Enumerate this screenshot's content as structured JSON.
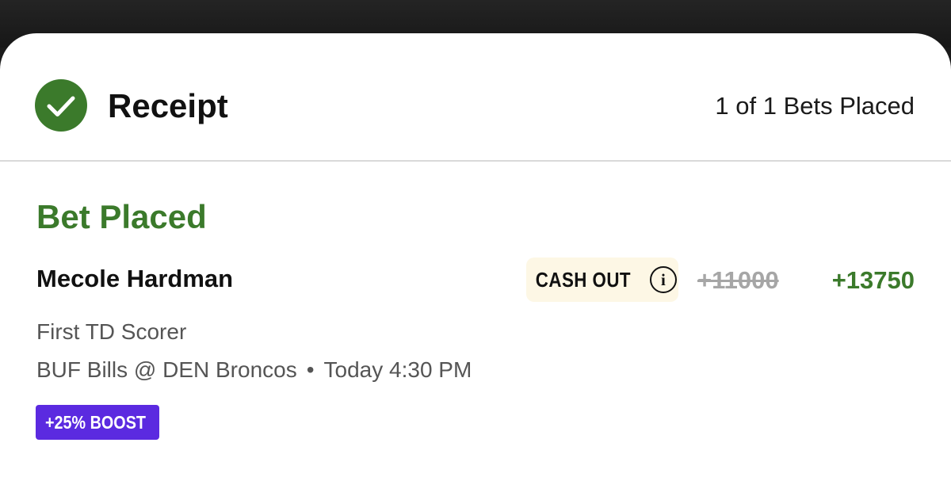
{
  "header": {
    "title": "Receipt",
    "bets_placed": "1 of 1 Bets Placed",
    "icon": "check-circle-icon",
    "accent_color": "#3b7a2b"
  },
  "bet": {
    "status": "Bet Placed",
    "selection": "Mecole Hardman",
    "cash_out_label": "CASH OUT",
    "info_icon_glyph": "i",
    "original_odds": "+11000",
    "boosted_odds": "+13750",
    "market": "First TD Scorer",
    "matchup": "BUF Bills @ DEN Broncos",
    "separator": "•",
    "start_time": "Today 4:30 PM",
    "boost_badge": "+25% BOOST",
    "boost_color": "#5b2ae0"
  }
}
